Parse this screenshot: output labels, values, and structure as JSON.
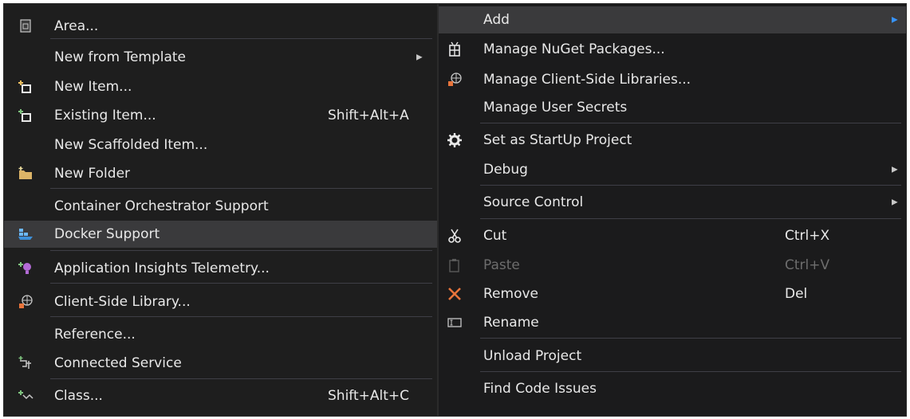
{
  "left_menu": {
    "items": [
      {
        "label": "Area...",
        "icon": "area-icon"
      },
      {
        "label": "New from Template",
        "submenu": true
      },
      {
        "label": "New Item...",
        "icon": "new-item-icon"
      },
      {
        "label": "Existing Item...",
        "shortcut": "Shift+Alt+A",
        "icon": "existing-item-icon"
      },
      {
        "label": "New Scaffolded Item..."
      },
      {
        "label": "New Folder",
        "icon": "new-folder-icon"
      },
      {
        "label": "Container Orchestrator Support"
      },
      {
        "label": "Docker Support",
        "icon": "docker-icon",
        "highlighted": true
      },
      {
        "label": "Application Insights Telemetry...",
        "icon": "app-insights-icon"
      },
      {
        "label": "Client-Side Library...",
        "icon": "client-library-icon"
      },
      {
        "label": "Reference..."
      },
      {
        "label": "Connected Service",
        "icon": "connected-service-icon"
      },
      {
        "label": "Class...",
        "shortcut": "Shift+Alt+C",
        "icon": "class-icon"
      }
    ]
  },
  "right_menu": {
    "items": [
      {
        "label": "Add",
        "submenu": true,
        "highlighted": true
      },
      {
        "label": "Manage NuGet Packages...",
        "icon": "nuget-icon"
      },
      {
        "label": "Manage Client-Side Libraries...",
        "icon": "client-library-icon"
      },
      {
        "label": "Manage User Secrets"
      },
      {
        "label": "Set as StartUp Project",
        "icon": "gear-icon"
      },
      {
        "label": "Debug",
        "submenu": true
      },
      {
        "label": "Source Control",
        "submenu": true
      },
      {
        "label": "Cut",
        "shortcut": "Ctrl+X",
        "icon": "cut-icon"
      },
      {
        "label": "Paste",
        "shortcut": "Ctrl+V",
        "icon": "paste-icon",
        "disabled": true
      },
      {
        "label": "Remove",
        "shortcut": "Del",
        "icon": "remove-icon"
      },
      {
        "label": "Rename",
        "icon": "rename-icon"
      },
      {
        "label": "Unload Project"
      },
      {
        "label": "Find Code Issues"
      }
    ]
  },
  "colors": {
    "menu_bg": "#1e1e1e",
    "highlight_bg": "#3a3a3c",
    "text": "#e8e8e8",
    "disabled_text": "#6d6d6d",
    "separator": "#3f3f46",
    "submenu_arrow_active": "#3794ff",
    "remove_icon": "#e8743b"
  }
}
